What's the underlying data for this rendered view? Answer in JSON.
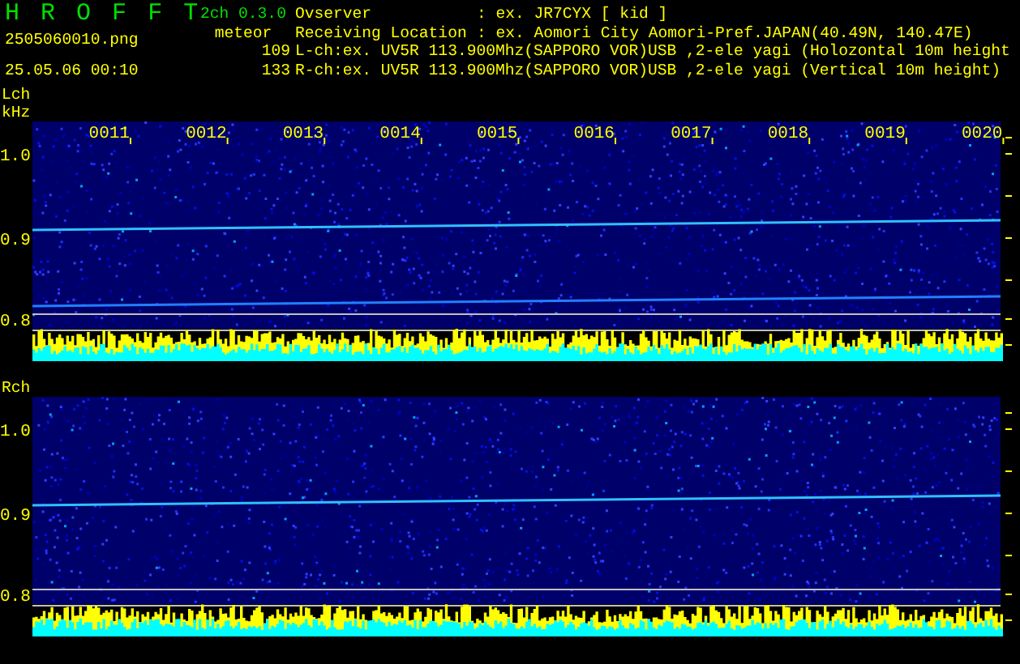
{
  "app_title_letters": [
    "H",
    "R",
    "O",
    "F",
    "F",
    "T"
  ],
  "version": "2ch 0.3.0",
  "mode": "meteor",
  "filename": "2505060010.png",
  "datetime": "25.05.06 00:10",
  "counts": [
    "109",
    "133"
  ],
  "info": [
    {
      "label": "Ovserver",
      "value": ": ex. JR7CYX [ kid ]"
    },
    {
      "label": "Receiving Location",
      "value": ": ex. Aomori City Aomori-Pref.JAPAN(40.49N, 140.47E)"
    }
  ],
  "channel_lines": [
    "L-ch:ex. UV5R 113.900Mhz(SAPPORO VOR)USB ,2-ele yagi (Holozontal 10m height",
    "R-ch:ex. UV5R 113.900Mhz(SAPPORO VOR)USB ,2-ele yagi (Vertical 10m height)"
  ],
  "channels": [
    {
      "label": "Lch",
      "unit": "kHz",
      "yticks": [
        "1.0",
        "0.9",
        "0.8"
      ],
      "time_labels": [
        "0011",
        "0012",
        "0013",
        "0014",
        "0015",
        "0016",
        "0017",
        "0018",
        "0019",
        "0020"
      ]
    },
    {
      "label": "Rch",
      "yticks": [
        "1.0",
        "0.9",
        "0.8"
      ]
    }
  ]
}
